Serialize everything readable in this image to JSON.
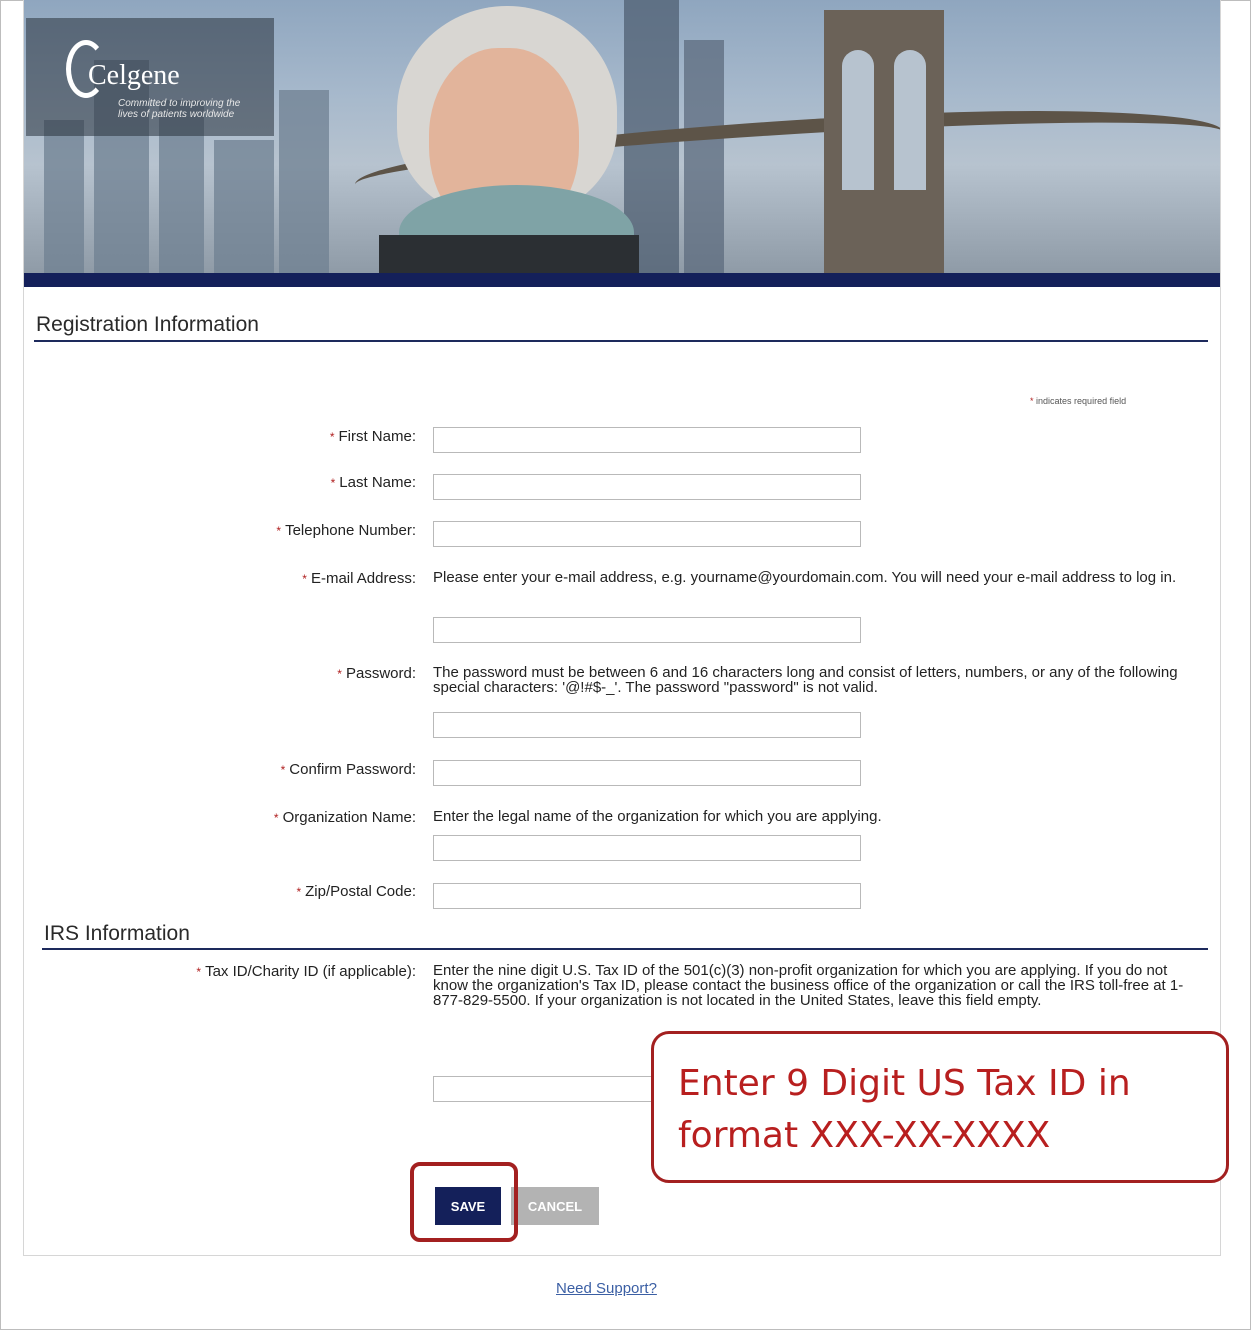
{
  "brand": {
    "name": "Celgene",
    "tagline": "Committed to improving the lives of patients worldwide"
  },
  "registration": {
    "title": "Registration Information",
    "required_note": "indicates required field",
    "fields": [
      {
        "label": "First Name:",
        "value": ""
      },
      {
        "label": "Last Name:",
        "value": ""
      },
      {
        "label": "Telephone Number:",
        "value": ""
      },
      {
        "label": "E-mail Address:",
        "hint": "Please enter your e-mail address, e.g. yourname@yourdomain.com. You will need your e-mail address to log in.",
        "value": ""
      },
      {
        "label": "Password:",
        "hint": "The password must be between 6 and 16 characters long and consist of letters, numbers, or any of the following special characters: '@!#$-_'. The password \"password\" is not valid.",
        "value": ""
      },
      {
        "label": "Confirm Password:",
        "value": ""
      },
      {
        "label": "Organization Name:",
        "hint": "Enter the legal name of the organization for which you are applying.",
        "value": ""
      },
      {
        "label": "Zip/Postal Code:",
        "value": ""
      }
    ]
  },
  "irs": {
    "title": "IRS Information",
    "tax_label": "Tax ID/Charity ID (if applicable):",
    "tax_hint": "Enter the nine digit U.S. Tax ID of the 501(c)(3) non-profit organization for which you are applying. If you do not know the organization's Tax ID, please contact the business office of the organization or call the IRS toll-free at 1-877-829-5500. If your organization is not located in the United States, leave this field empty.",
    "tax_value": ""
  },
  "buttons": {
    "save": "SAVE",
    "cancel": "CANCEL"
  },
  "callout": {
    "line1": "Enter 9 Digit US Tax ID in",
    "line2": "format XXX-XX-XXXX"
  },
  "footer": {
    "support_link": "Need Support?"
  },
  "colors": {
    "navy": "#14205a",
    "required_star": "#b02020",
    "annotation_red": "#a32020",
    "link": "#3b5fa4"
  }
}
